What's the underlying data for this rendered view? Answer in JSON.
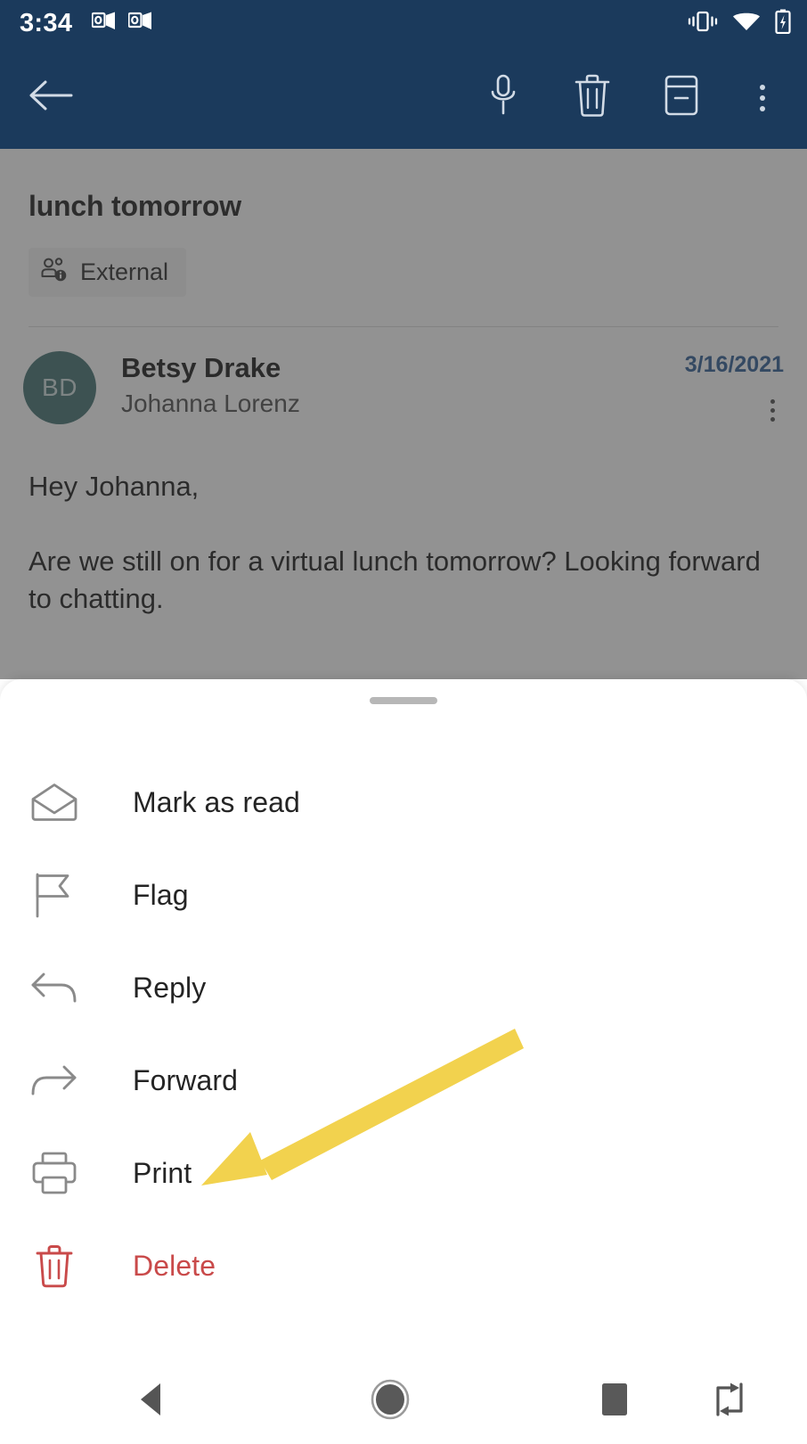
{
  "status_bar": {
    "clock": "3:34",
    "left_icons": [
      "outlook-notification-icon",
      "outlook-notification-icon"
    ],
    "right_icons": [
      "vibrate-icon",
      "wifi-icon",
      "battery-charging-icon"
    ]
  },
  "app_bar": {
    "back_icon": "back-arrow-icon",
    "actions": [
      {
        "name": "microphone-icon",
        "label": "Voice"
      },
      {
        "name": "trash-icon",
        "label": "Delete"
      },
      {
        "name": "archive-icon",
        "label": "Archive"
      },
      {
        "name": "overflow-menu-icon",
        "label": "More options"
      }
    ]
  },
  "email": {
    "subject": "lunch tomorrow",
    "external_badge": "External",
    "sender": "Betsy Drake",
    "recipient": "Johanna Lorenz",
    "date": "3/16/2021",
    "avatar_initials": "BD",
    "avatar_color": "#3f6e6e",
    "date_color": "#2a5a93",
    "body_paragraphs": [
      "Hey Johanna,",
      "Are we still on for a virtual lunch tomorrow? Looking forward to chatting."
    ]
  },
  "sheet": {
    "handle": "drag-handle",
    "menu_items": [
      {
        "label": "Mark as read",
        "icon": "envelope-open-icon",
        "danger": false
      },
      {
        "label": "Flag",
        "icon": "flag-icon",
        "danger": false
      },
      {
        "label": "Reply",
        "icon": "reply-arrow-icon",
        "danger": false
      },
      {
        "label": "Forward",
        "icon": "forward-arrow-icon",
        "danger": false
      },
      {
        "label": "Print",
        "icon": "printer-icon",
        "danger": false
      },
      {
        "label": "Delete",
        "icon": "trash-icon",
        "danger": true
      }
    ]
  },
  "annotation": {
    "arrow_color": "#F2D24E",
    "points_at": "Print"
  },
  "nav_bar": {
    "buttons": [
      {
        "name": "nav-back-icon",
        "label": "Back"
      },
      {
        "name": "nav-home-icon",
        "label": "Home"
      },
      {
        "name": "nav-recents-icon",
        "label": "Recents"
      },
      {
        "name": "nav-rotate-icon",
        "label": "Rotate screen"
      }
    ]
  },
  "colors": {
    "app_bar": "#1b3a5c",
    "danger": "#c94a4a",
    "accent": "#F2D24E"
  }
}
